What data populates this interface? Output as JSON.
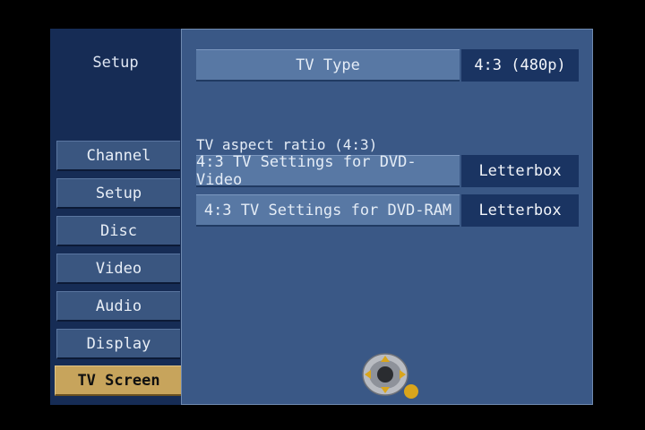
{
  "sidebar": {
    "title": "Setup",
    "items": [
      {
        "label": "Channel"
      },
      {
        "label": "Setup"
      },
      {
        "label": "Disc"
      },
      {
        "label": "Video"
      },
      {
        "label": "Audio"
      },
      {
        "label": "Display"
      },
      {
        "label": "TV Screen"
      }
    ],
    "active_item": "TV Screen"
  },
  "main": {
    "tv_type": {
      "label": "TV Type",
      "value": "4:3 (480p)"
    },
    "section_heading": "TV aspect ratio (4:3)",
    "settings": [
      {
        "label": "4:3 TV Settings for DVD-Video",
        "value": "Letterbox"
      },
      {
        "label": "4:3 TV Settings for DVD-RAM",
        "value": "Letterbox"
      }
    ]
  },
  "controls": {
    "nav_pad_icon": "directional-pad-icon",
    "indicator_icon": "yellow-dot-icon"
  },
  "colors": {
    "background": "#000000",
    "screen": "#162c55",
    "panel": "#3a5886",
    "menu_item": "#3a5680",
    "menu_active": "#c7a45c",
    "row_label": "#5878a4",
    "row_value": "#1a3462"
  }
}
